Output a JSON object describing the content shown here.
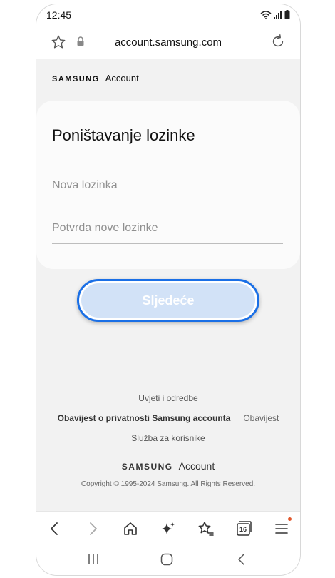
{
  "status": {
    "time": "12:45"
  },
  "browser": {
    "url": "account.samsung.com",
    "icons": [
      "bookmark-star-icon",
      "lock-icon",
      "reload-icon"
    ]
  },
  "brand": {
    "logo": "SAMSUNG",
    "product": "Account"
  },
  "form": {
    "title": "Poništavanje lozinke",
    "new_password_placeholder": "Nova lozinka",
    "confirm_password_placeholder": "Potvrda nove lozinke",
    "next_label": "Sljedeće"
  },
  "footer": {
    "terms": "Uvjeti i odredbe",
    "privacy": "Obavijest o privatnosti Samsung accounta",
    "notice": "Obavijest",
    "support": "Služba za korisnike",
    "brand_logo": "SAMSUNG",
    "brand_product": "Account",
    "copyright": "Copyright © 1995-2024 Samsung. All Rights Reserved."
  },
  "toolbar": {
    "tab_count": "16",
    "icons": [
      "back-icon",
      "forward-icon",
      "home-icon",
      "sparkle-icon",
      "bookmarks-icon",
      "tabs-icon",
      "menu-icon"
    ]
  },
  "colors": {
    "accent": "#1a6fe6",
    "button_fill": "#d2e2f7",
    "background": "#f2f2f2",
    "notification": "#e2572b"
  }
}
